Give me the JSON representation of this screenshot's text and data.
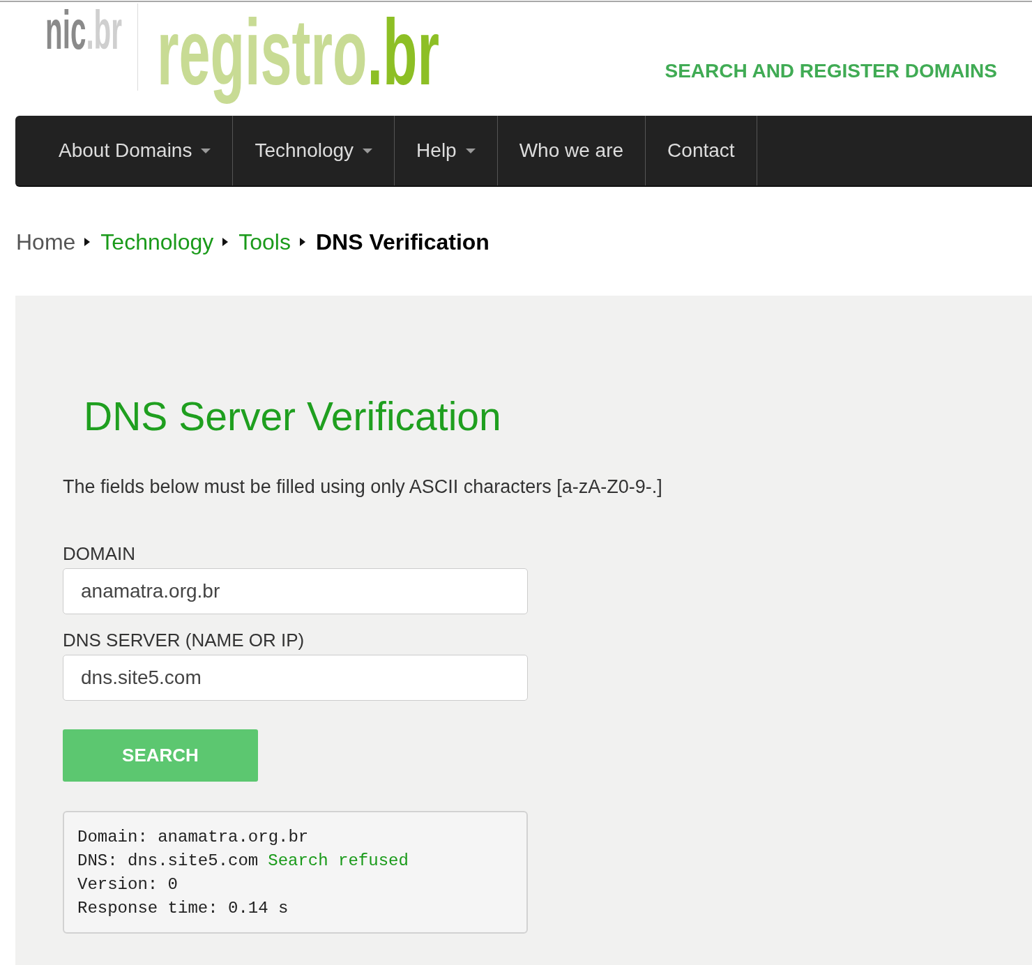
{
  "header": {
    "org_logo": {
      "text": "nic",
      "suffix": ".br"
    },
    "registry_logo": {
      "text": "registro",
      "suffix": ".br"
    },
    "tagline": "SEARCH AND REGISTER DOMAINS"
  },
  "nav": {
    "items": [
      {
        "label": "About Domains",
        "dropdown": true
      },
      {
        "label": "Technology",
        "dropdown": true
      },
      {
        "label": "Help",
        "dropdown": true
      },
      {
        "label": "Who we are",
        "dropdown": false
      },
      {
        "label": "Contact",
        "dropdown": false
      }
    ]
  },
  "breadcrumb": [
    {
      "label": "Home",
      "kind": "home"
    },
    {
      "label": "Technology",
      "kind": "link"
    },
    {
      "label": "Tools",
      "kind": "link"
    },
    {
      "label": "DNS Verification",
      "kind": "current"
    }
  ],
  "form": {
    "title": "DNS Server Verification",
    "instructions": "The fields below must be filled using only ASCII characters [a-zA-Z0-9-.]",
    "fields": [
      {
        "label": "DOMAIN",
        "value": "anamatra.org.br"
      },
      {
        "label": "DNS SERVER (NAME OR IP)",
        "value": "dns.site5.com"
      }
    ],
    "button": "SEARCH"
  },
  "result": {
    "lines": [
      {
        "text": "Domain: anamatra.org.br"
      },
      {
        "text": "DNS: dns.site5.com",
        "status": "Search refused"
      },
      {
        "text": "Version: 0"
      },
      {
        "text": "Response time: 0.14 s"
      }
    ]
  }
}
